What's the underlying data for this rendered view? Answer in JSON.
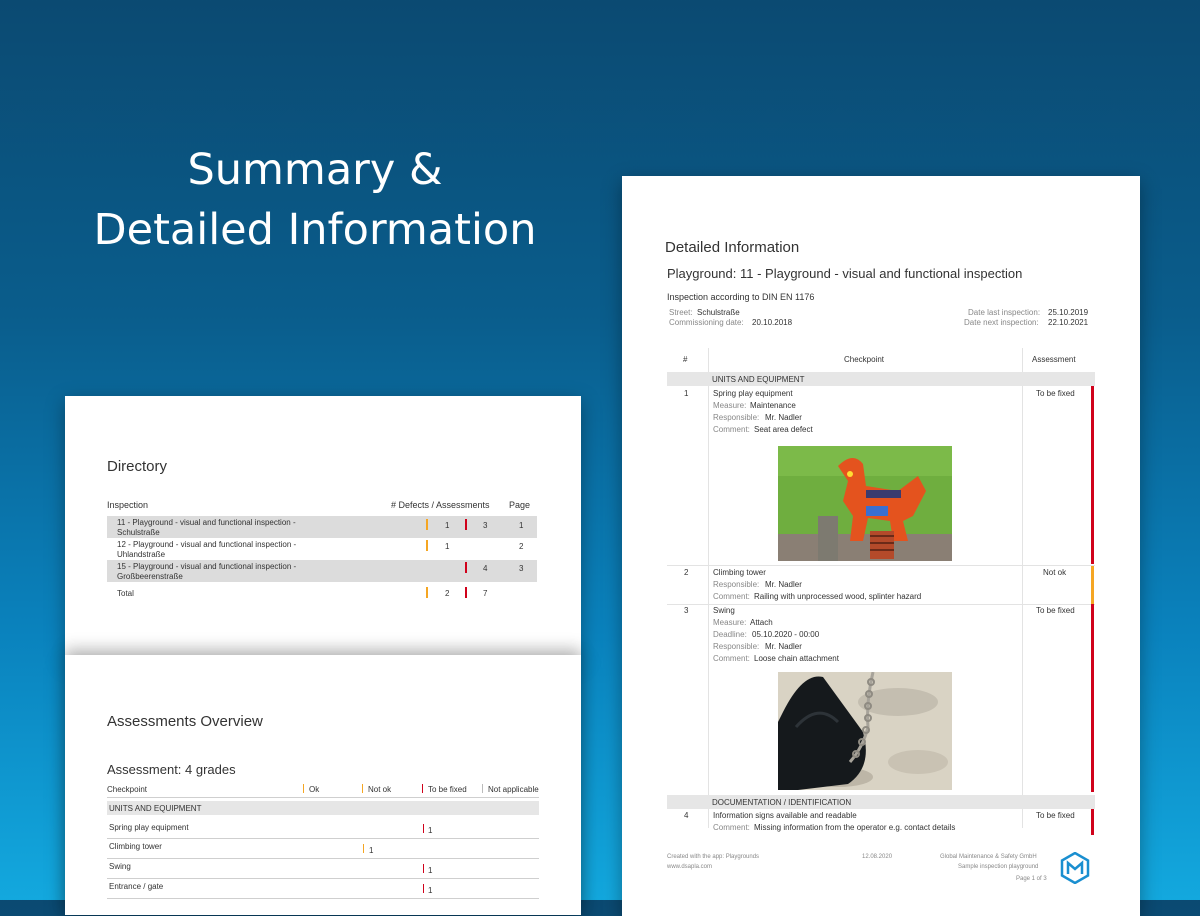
{
  "headline": {
    "line1": "Summary &",
    "line2": "Detailed Information"
  },
  "directory": {
    "title": "Directory",
    "col_inspection": "Inspection",
    "col_defects": "# Defects / Assessments",
    "col_page": "Page",
    "rows": [
      {
        "name_line1": "11 - Playground - visual and functional inspection -",
        "name_line2": "Schulstraße",
        "orange": "1",
        "red": "3",
        "page": "1"
      },
      {
        "name_line1": "12 - Playground - visual and functional inspection -",
        "name_line2": "Uhlandstraße",
        "orange": "1",
        "red": "",
        "page": "2"
      },
      {
        "name_line1": "15 - Playground - visual and functional inspection -",
        "name_line2": "Großbeerenstraße",
        "orange": "",
        "red": "4",
        "page": "3"
      }
    ],
    "total_label": "Total",
    "total_orange": "2",
    "total_red": "7"
  },
  "overview": {
    "title": "Assessments Overview",
    "subtitle": "Assessment: 4 grades",
    "col_checkpoint": "Checkpoint",
    "col_ok": "Ok",
    "col_notok": "Not ok",
    "col_tobefixed": "To be fixed",
    "col_na": "Not applicable",
    "section": "UNITS AND EQUIPMENT",
    "rows": [
      {
        "name": "Spring play equipment",
        "value": "1"
      },
      {
        "name": "Climbing tower",
        "value": "1"
      },
      {
        "name": "Swing",
        "value": "1"
      },
      {
        "name": "Entrance / gate",
        "value": "1"
      }
    ]
  },
  "detail": {
    "title": "Detailed Information",
    "subtitle": "Playground: 11 - Playground - visual and functional inspection",
    "standard": "Inspection according to DIN EN 1176",
    "street_label": "Street:",
    "street_value": "Schulstraße",
    "commission_label": "Commissioning date:",
    "commission_value": "20.10.2018",
    "last_label": "Date last inspection:",
    "last_value": "25.10.2019",
    "next_label": "Date next inspection:",
    "next_value": "22.10.2021",
    "col_num": "#",
    "col_checkpoint": "Checkpoint",
    "col_assessment": "Assessment",
    "section1": "UNITS AND EQUIPMENT",
    "item1": {
      "num": "1",
      "name": "Spring play equipment",
      "measure_label": "Measure:",
      "measure": "Maintenance",
      "resp_label": "Responsible:",
      "resp": "Mr. Nadler",
      "comment_label": "Comment:",
      "comment": "Seat area defect",
      "assessment": "To be fixed"
    },
    "item2": {
      "num": "2",
      "name": "Climbing tower",
      "resp_label": "Responsible:",
      "resp": "Mr. Nadler",
      "comment_label": "Comment:",
      "comment": "Railing with unprocessed wood, splinter hazard",
      "assessment": "Not ok"
    },
    "item3": {
      "num": "3",
      "name": "Swing",
      "measure_label": "Measure:",
      "measure": "Attach",
      "deadline_label": "Deadline:",
      "deadline": "05.10.2020 - 00:00",
      "resp_label": "Responsible:",
      "resp": "Mr. Nadler",
      "comment_label": "Comment:",
      "comment": "Loose chain attachment",
      "assessment": "To be fixed"
    },
    "section2": "DOCUMENTATION / IDENTIFICATION",
    "item4": {
      "num": "4",
      "name": "Information signs available and readable",
      "comment_label": "Comment:",
      "comment": "Missing information from the operator e.g. contact details",
      "assessment": "To be fixed"
    },
    "footer_created": "Created with the app: Playgrounds",
    "footer_web": "www.dsapla.com",
    "footer_date": "12.08.2020",
    "footer_company": "Global Maintenance & Safety GmbH",
    "footer_doc": "Sample inspection playground",
    "footer_page": "Page 1 of 3",
    "colors": {
      "red": "#d0021b",
      "orange": "#f5a623"
    }
  }
}
